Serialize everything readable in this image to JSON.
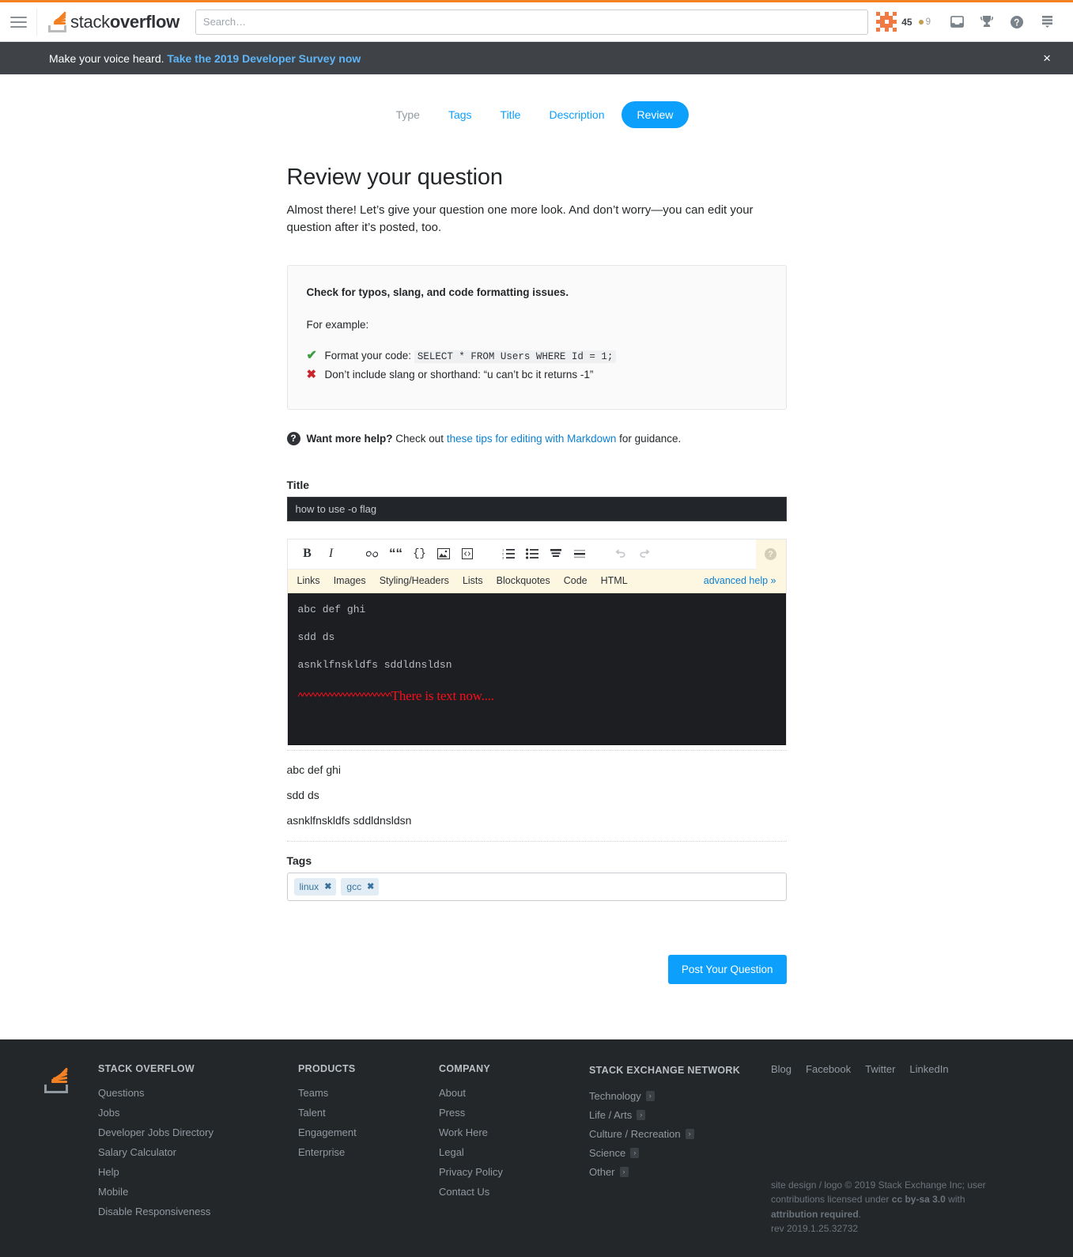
{
  "header": {
    "logo_text_light": "stack",
    "logo_text_bold": "overflow",
    "search_placeholder": "Search…",
    "search_value": "",
    "reputation": "45",
    "badge_count": "9",
    "inbox_label": "Inbox",
    "achievements_label": "Achievements",
    "help_label": "Help",
    "site_switcher_label": "Site switcher"
  },
  "notice": {
    "text": "Make your voice heard. ",
    "link": "Take the 2019 Developer Survey now",
    "close": "×"
  },
  "steps": [
    {
      "label": "Type",
      "state": "muted"
    },
    {
      "label": "Tags",
      "state": "link"
    },
    {
      "label": "Title",
      "state": "link"
    },
    {
      "label": "Description",
      "state": "link"
    },
    {
      "label": "Review",
      "state": "active"
    }
  ],
  "main": {
    "heading": "Review your question",
    "lede": "Almost there! Let’s give your question one more look. And don’t worry—you can edit your question after it’s posted, too."
  },
  "tipbox": {
    "heading": "Check for typos, slang, and code formatting issues.",
    "for_example": "For example:",
    "good_text": "Format your code:",
    "good_code": "SELECT * FROM Users WHERE Id = 1;",
    "bad_text": "Don’t include slang or shorthand: “u can’t bc it returns -1”",
    "check_glyph": "✔",
    "x_glyph": "✖"
  },
  "helpline": {
    "icon_glyph": "?",
    "bold": "Want more help?",
    "before_link": " Check out ",
    "link": "these tips for editing with Markdown",
    "after_link": " for guidance."
  },
  "title_field": {
    "label": "Title",
    "value": "how to use -o flag",
    "placeholder": "Title"
  },
  "editor": {
    "toolbar": [
      {
        "name": "bold",
        "glyph": "B"
      },
      {
        "name": "italic",
        "glyph": "I"
      },
      {
        "name": "link",
        "glyph": "&"
      },
      {
        "name": "blockquote",
        "glyph": "“"
      },
      {
        "name": "code",
        "glyph": "{}"
      },
      {
        "name": "image",
        "glyph": "▣"
      },
      {
        "name": "html-snippet",
        "glyph": "‹›"
      },
      {
        "name": "numbered-list",
        "glyph": "1."
      },
      {
        "name": "bulleted-list",
        "glyph": "•"
      },
      {
        "name": "heading",
        "glyph": "H"
      },
      {
        "name": "horizontal-rule",
        "glyph": "—"
      },
      {
        "name": "undo",
        "glyph": "↶"
      },
      {
        "name": "redo",
        "glyph": "↷"
      }
    ],
    "help_items": [
      "Links",
      "Images",
      "Styling/Headers",
      "Lists",
      "Blockquotes",
      "Code",
      "HTML"
    ],
    "advanced_help": "advanced help »",
    "help_tab_glyph": "?",
    "body_lines": [
      "abc def ghi",
      "sdd ds",
      "asnklfnskldfs sddldnsldsn"
    ],
    "annotation_carets": "^^^^^^^^^^^^^^^^^^^^^^",
    "annotation_text": "There is text now...."
  },
  "preview": {
    "paragraphs": [
      "abc def ghi",
      "sdd ds",
      "asnklfnskldfs sddldnsldsn"
    ]
  },
  "tags": {
    "label": "Tags",
    "items": [
      {
        "name": "linux",
        "remove": "✖"
      },
      {
        "name": "gcc",
        "remove": "✖"
      }
    ]
  },
  "submit": {
    "label": "Post Your Question"
  },
  "footer": {
    "columns": [
      {
        "heading": "Stack Overflow",
        "links": [
          "Questions",
          "Jobs",
          "Developer Jobs Directory",
          "Salary Calculator",
          "Help",
          "Mobile",
          "Disable Responsiveness"
        ]
      },
      {
        "heading": "Products",
        "links": [
          "Teams",
          "Talent",
          "Engagement",
          "Enterprise"
        ]
      },
      {
        "heading": "Company",
        "links": [
          "About",
          "Press",
          "Work Here",
          "Legal",
          "Privacy Policy",
          "Contact Us"
        ]
      }
    ],
    "network": {
      "heading": "Stack Exchange Network",
      "items": [
        "Technology",
        "Life / Arts",
        "Culture / Recreation",
        "Science",
        "Other"
      ],
      "chevron": "›"
    },
    "social": [
      "Blog",
      "Facebook",
      "Twitter",
      "LinkedIn"
    ],
    "legal_part1": "site design / logo © 2019 Stack Exchange Inc; user contributions licensed under ",
    "legal_cc": "cc by-sa 3.0",
    "legal_part2": " with ",
    "legal_attr": "attribution required",
    "legal_part3": ".",
    "rev": "rev 2019.1.25.32732"
  },
  "colors": {
    "accent_orange": "#f48024",
    "link_blue": "#0c80d1",
    "primary_blue": "#0c9ffb",
    "footer_bg": "#242729",
    "notice_bg": "#3f4347",
    "editor_bg": "#1c1e22",
    "annotation_red": "#fc0d1b",
    "tag_bg": "#e1ecf4",
    "tag_fg": "#39739d"
  }
}
